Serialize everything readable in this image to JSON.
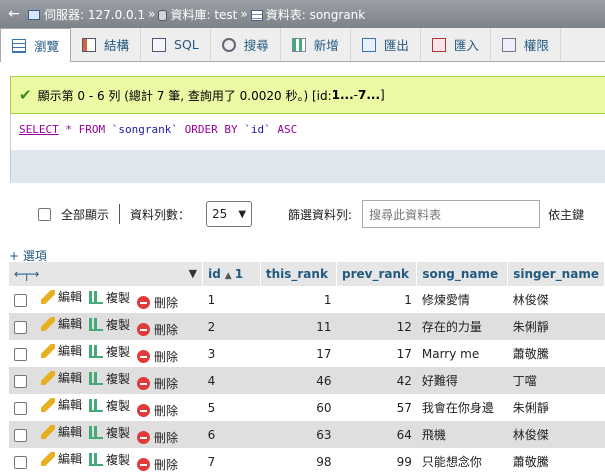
{
  "breadcrumb": {
    "back": "←",
    "server": "伺服器: 127.0.0.1",
    "sep": "»",
    "database": "資料庫: test",
    "table": "資料表: songrank"
  },
  "tabs": [
    {
      "label": "瀏覽",
      "icon": "browse-icon"
    },
    {
      "label": "結構",
      "icon": "structure-icon"
    },
    {
      "label": "SQL",
      "icon": "sql-icon"
    },
    {
      "label": "搜尋",
      "icon": "search-icon"
    },
    {
      "label": "新增",
      "icon": "insert-icon"
    },
    {
      "label": "匯出",
      "icon": "export-icon"
    },
    {
      "label": "匯入",
      "icon": "import-icon"
    },
    {
      "label": "權限",
      "icon": "privileges-icon"
    }
  ],
  "message": {
    "text": "顯示第 0 - 6 列 (總計 7 筆, 查詢用了 0.0020 秒。) [id: ",
    "range_start": "1...",
    "range_mid": " - ",
    "range_end": "7...",
    "close": "]"
  },
  "sql": {
    "select": "SELECT",
    "star_from": " * FROM ",
    "table": "`songrank`",
    "order_by": " ORDER BY ",
    "column": "`id`",
    "asc": " ASC"
  },
  "nav": {
    "show_all": "全部顯示",
    "rows_label": "資料列數：",
    "rows_value": "25",
    "filter_label": "篩選資料列:",
    "filter_placeholder": "搜尋此資料表",
    "sort_label": "依主鍵"
  },
  "options_link": "+ 選項",
  "columns": {
    "id": "id",
    "sort_order": "1",
    "this_rank": "this_rank",
    "prev_rank": "prev_rank",
    "song_name": "song_name",
    "singer_name": "singer_name"
  },
  "actions": {
    "edit": "編輯",
    "copy": "複製",
    "delete": "刪除"
  },
  "rows": [
    {
      "id": "1",
      "this_rank": "1",
      "prev_rank": "1",
      "song_name": "修煉愛情",
      "singer_name": "林俊傑"
    },
    {
      "id": "2",
      "this_rank": "11",
      "prev_rank": "12",
      "song_name": "存在的力量",
      "singer_name": "朱俐靜"
    },
    {
      "id": "3",
      "this_rank": "17",
      "prev_rank": "17",
      "song_name": "Marry me",
      "singer_name": "蕭敬騰"
    },
    {
      "id": "4",
      "this_rank": "46",
      "prev_rank": "42",
      "song_name": "好難得",
      "singer_name": "丁噹"
    },
    {
      "id": "5",
      "this_rank": "60",
      "prev_rank": "57",
      "song_name": "我會在你身邊",
      "singer_name": "朱俐靜"
    },
    {
      "id": "6",
      "this_rank": "63",
      "prev_rank": "64",
      "song_name": "飛機",
      "singer_name": "林俊傑"
    },
    {
      "id": "7",
      "this_rank": "98",
      "prev_rank": "99",
      "song_name": "只能想念你",
      "singer_name": "蕭敬騰"
    }
  ]
}
